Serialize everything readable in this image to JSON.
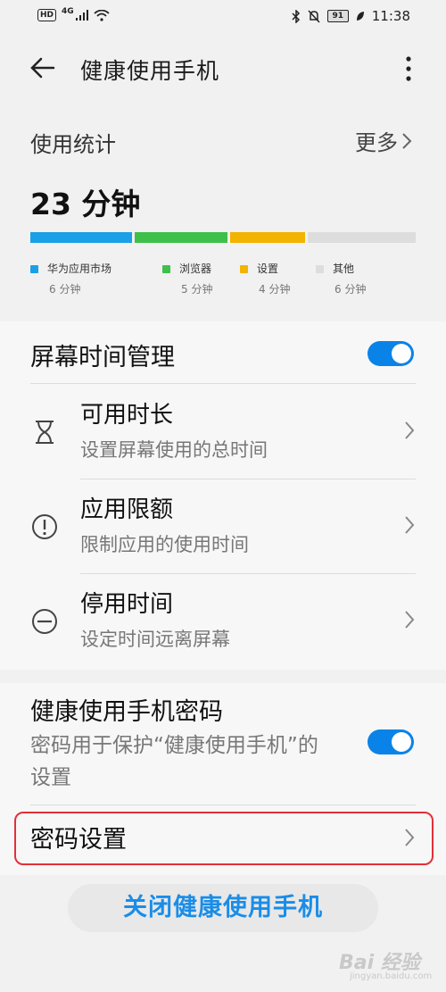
{
  "status": {
    "left_badge": "HD",
    "network": "4G",
    "battery": "91",
    "time": "11:38"
  },
  "header": {
    "title": "健康使用手机"
  },
  "stats": {
    "title": "使用统计",
    "more": "更多",
    "total": "23 分钟",
    "apps": [
      {
        "name": "华为应用市场",
        "duration": "6 分钟",
        "color": "#1aa0e6"
      },
      {
        "name": "浏览器",
        "duration": "5 分钟",
        "color": "#3ec04a"
      },
      {
        "name": "设置",
        "duration": "4 分钟",
        "color": "#f2b400"
      },
      {
        "name": "其他",
        "duration": "6 分钟",
        "color": "#dddddd"
      }
    ]
  },
  "screen_time": {
    "title": "屏幕时间管理",
    "enabled": true,
    "items": [
      {
        "title": "可用时长",
        "subtitle": "设置屏幕使用的总时间",
        "icon": "hourglass-icon"
      },
      {
        "title": "应用限额",
        "subtitle": "限制应用的使用时间",
        "icon": "exclamation-circle-icon"
      },
      {
        "title": "停用时间",
        "subtitle": "设定时间远离屏幕",
        "icon": "minus-circle-icon"
      }
    ]
  },
  "password": {
    "title": "健康使用手机密码",
    "subtitle": "密码用于保护“健康使用手机”的设置",
    "enabled": true,
    "setting_label": "密码设置"
  },
  "close_button": "关闭健康使用手机",
  "watermark": {
    "text": "Bai 经验",
    "sub": "jingyan.baidu.com"
  }
}
